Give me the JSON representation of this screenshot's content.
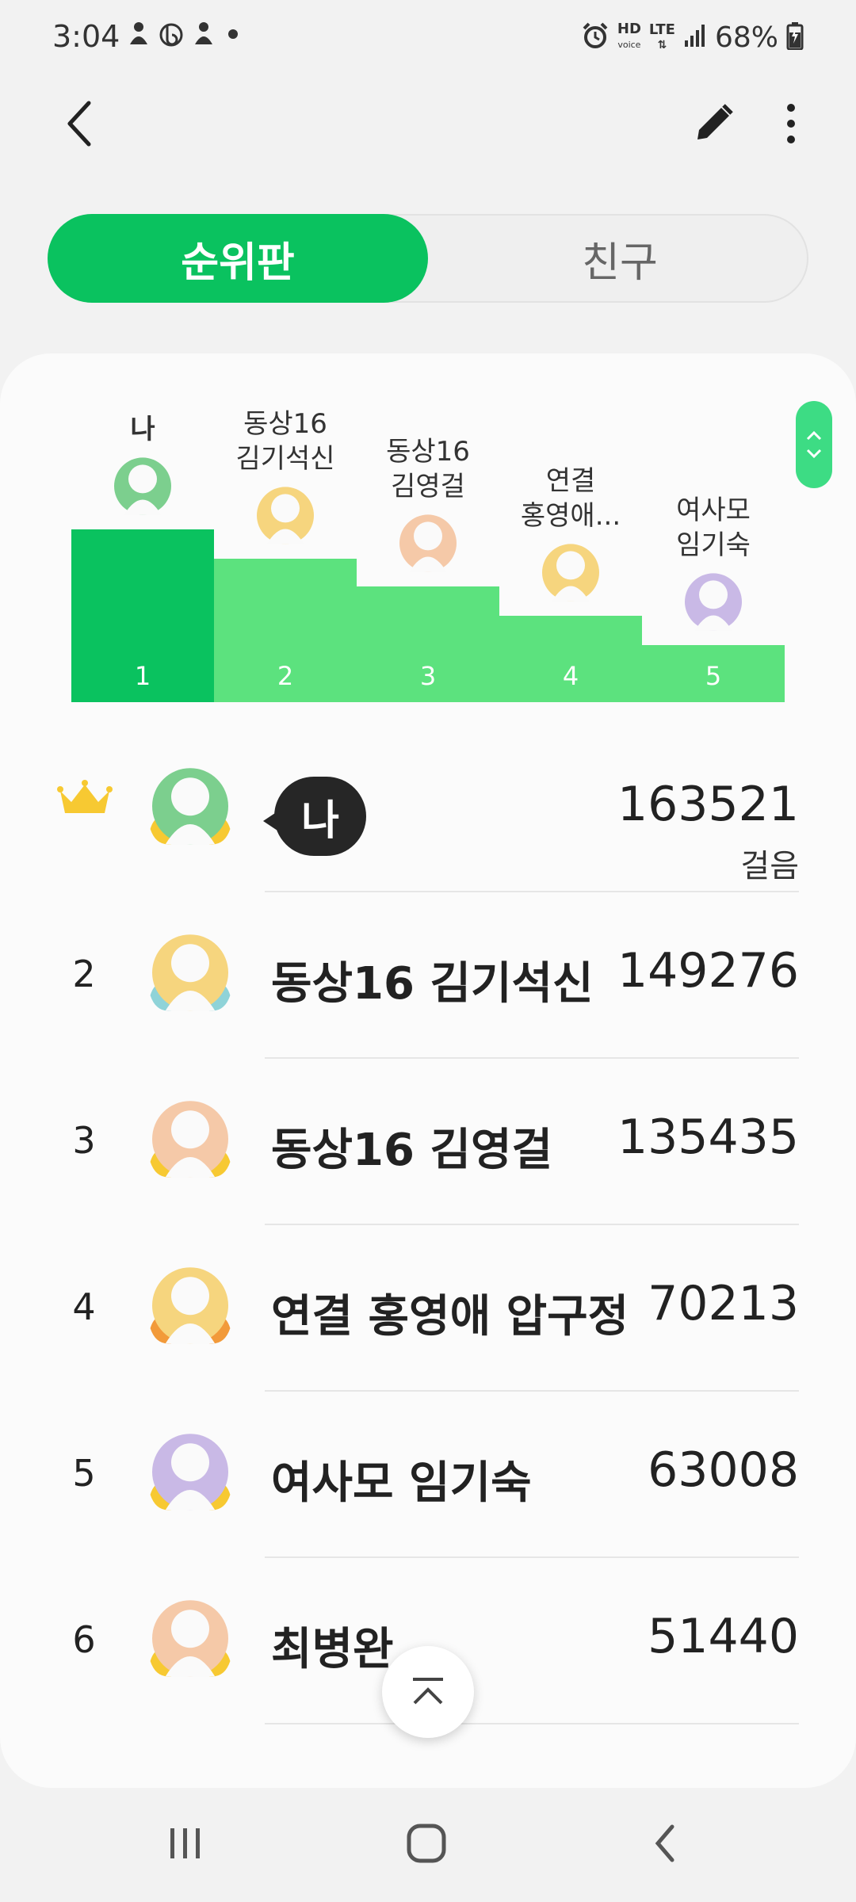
{
  "status_bar": {
    "time": "3:04",
    "network_hd": "HD",
    "network_voice": "voice",
    "network_lte": "LTE",
    "battery": "68%"
  },
  "tabs": {
    "leaderboard": "순위판",
    "friends": "친구"
  },
  "podium": [
    {
      "rank": "1",
      "label_line1": "나",
      "label_line2": "",
      "avatar_color": "#7ccf8e",
      "level": 1.0
    },
    {
      "rank": "2",
      "label_line1": "동상16",
      "label_line2": "김기석신",
      "avatar_color": "#f6d57e",
      "level": 0.83
    },
    {
      "rank": "3",
      "label_line1": "동상16",
      "label_line2": "김영걸",
      "avatar_color": "#f5c9a8",
      "level": 0.67
    },
    {
      "rank": "4",
      "label_line1": "연결",
      "label_line2": "홍영애...",
      "avatar_color": "#f6d57e",
      "level": 0.5
    },
    {
      "rank": "5",
      "label_line1": "여사모",
      "label_line2": "임기숙",
      "avatar_color": "#c9b9e6",
      "level": 0.33
    }
  ],
  "ranking": [
    {
      "rank": "1",
      "name": "나",
      "steps": "163521",
      "unit": "걸음",
      "avatar_color": "#7ccf8e",
      "wing_color": "#f7c932",
      "is_me": true
    },
    {
      "rank": "2",
      "name": "동상16 김기석신",
      "steps": "149276",
      "avatar_color": "#f6d57e",
      "wing_color": "#8fd3d8"
    },
    {
      "rank": "3",
      "name": "동상16 김영걸",
      "steps": "135435",
      "avatar_color": "#f5c9a8",
      "wing_color": "#f7c932"
    },
    {
      "rank": "4",
      "name": "연결 홍영애 압구정",
      "steps": "70213",
      "avatar_color": "#f6d57e",
      "wing_color": "#f29a3a"
    },
    {
      "rank": "5",
      "name": "여사모 임기숙",
      "steps": "63008",
      "avatar_color": "#c9b9e6",
      "wing_color": "#f7c932"
    },
    {
      "rank": "6",
      "name": "최병완",
      "steps": "51440",
      "avatar_color": "#f5c9a8",
      "wing_color": "#f7c932"
    }
  ],
  "colors": {
    "accent": "#0ac25f",
    "podium_first": "#0ac25f",
    "podium_other": "#5ce27e",
    "crown": "#f7c932"
  }
}
